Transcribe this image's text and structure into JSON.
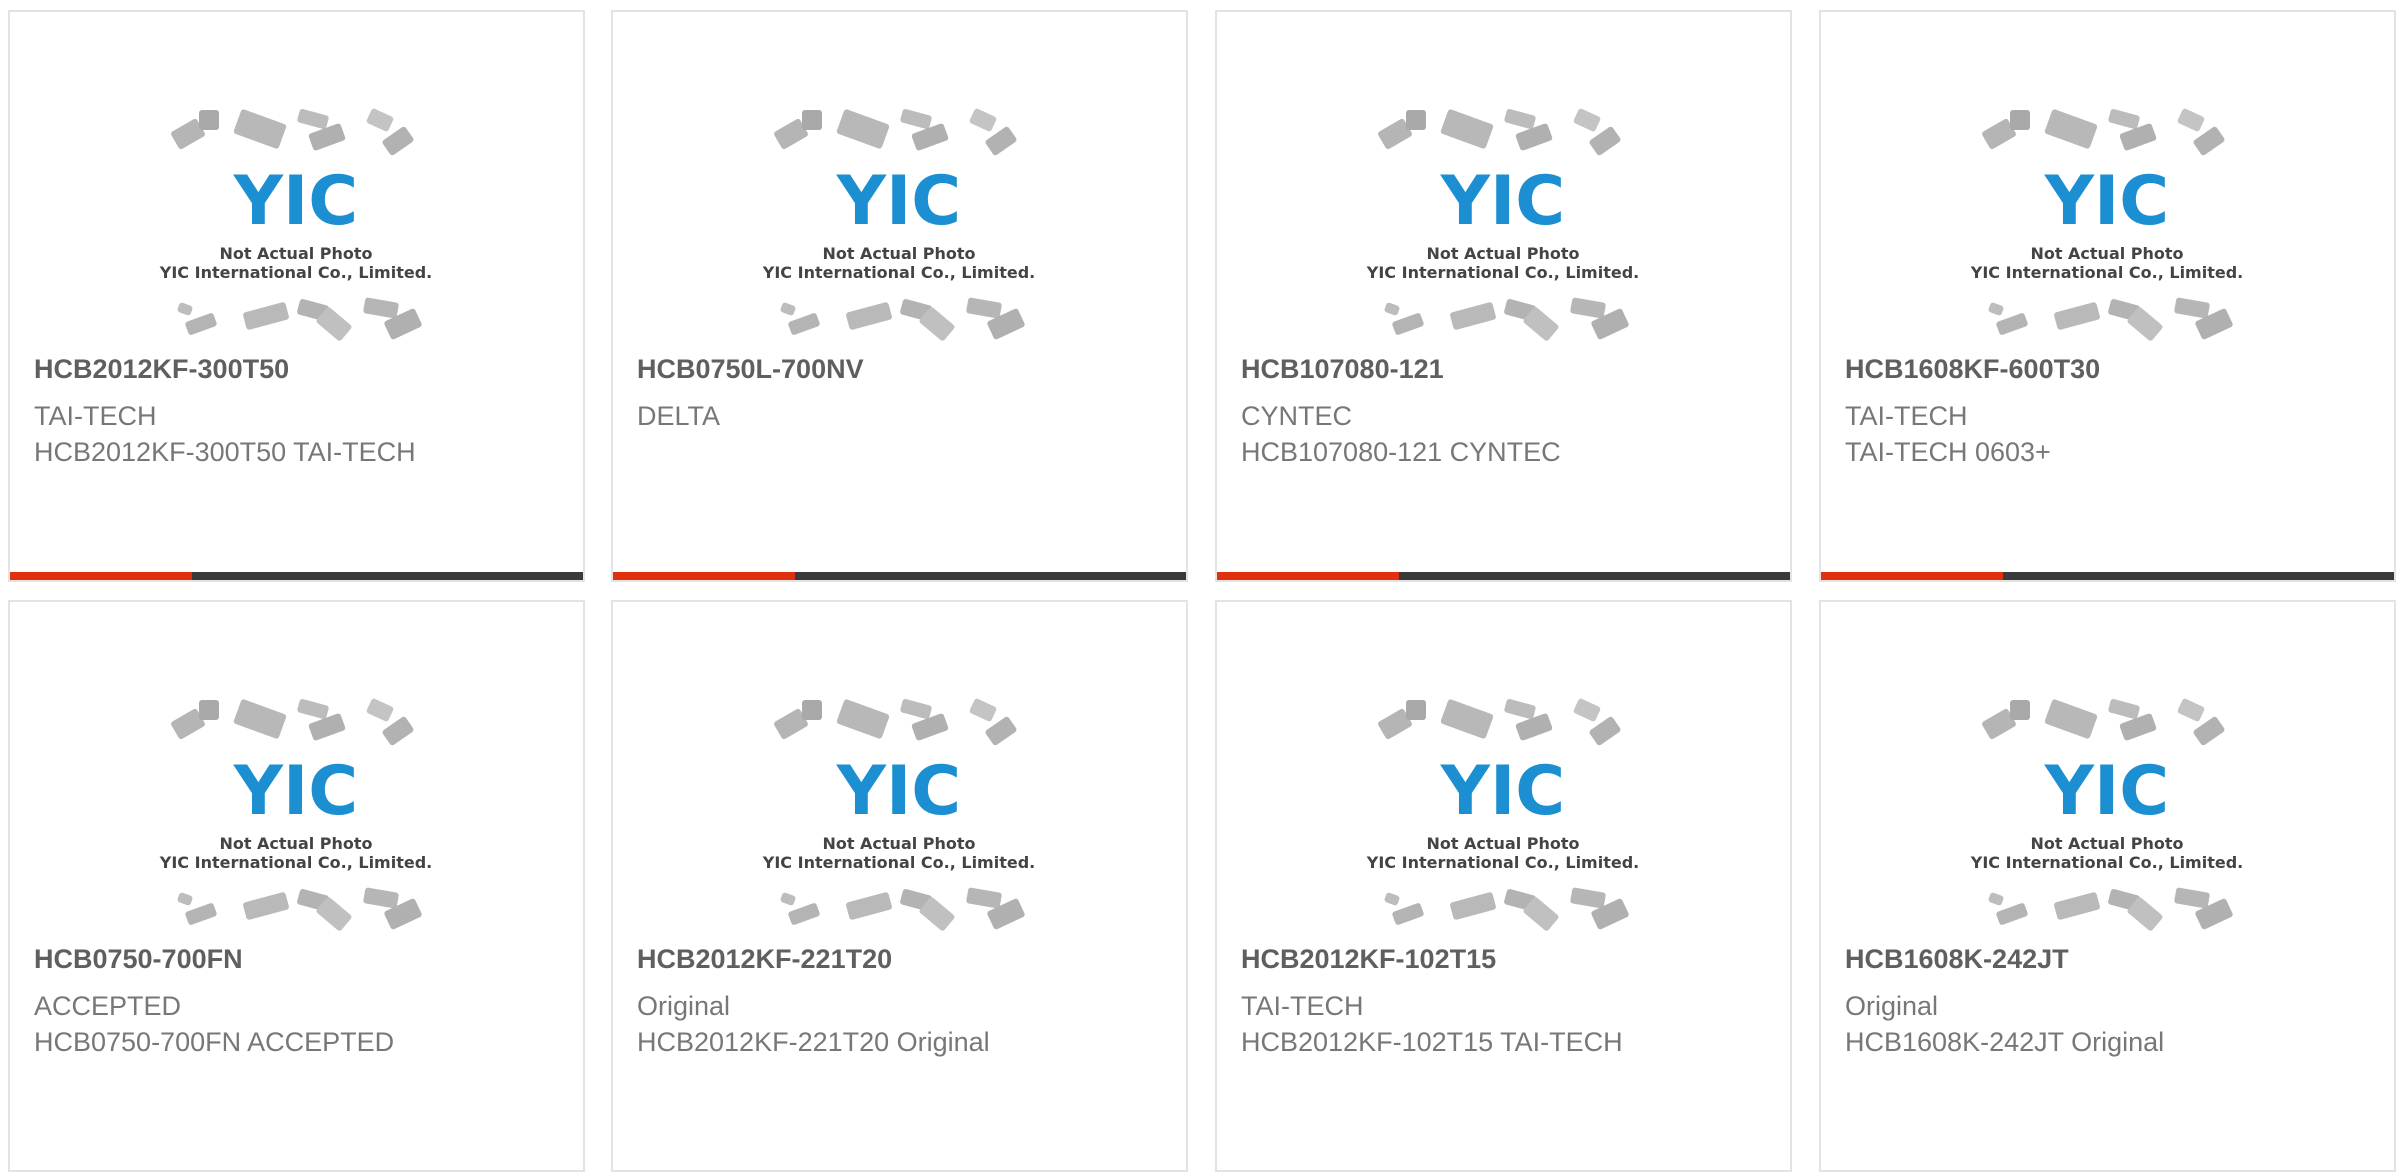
{
  "brand": {
    "accent_color": "#e0300e",
    "bar_color": "#3a3a3a",
    "logo_color": "#1b8fd1"
  },
  "placeholder_image": {
    "logo_text": "YIC",
    "caption_line1": "Not Actual Photo",
    "caption_line2": "YIC International Co., Limited."
  },
  "products": [
    {
      "part": "HCB2012KF-300T50",
      "line1": "TAI-TECH",
      "line2": "HCB2012KF-300T50 TAI-TECH"
    },
    {
      "part": "HCB0750L-700NV",
      "line1": "DELTA",
      "line2": ""
    },
    {
      "part": "HCB107080-121",
      "line1": "CYNTEC",
      "line2": "HCB107080-121 CYNTEC"
    },
    {
      "part": "HCB1608KF-600T30",
      "line1": "TAI-TECH",
      "line2": "TAI-TECH 0603+"
    },
    {
      "part": "HCB0750-700FN",
      "line1": "ACCEPTED",
      "line2": "HCB0750-700FN ACCEPTED"
    },
    {
      "part": "HCB2012KF-221T20",
      "line1": "Original",
      "line2": "HCB2012KF-221T20 Original"
    },
    {
      "part": "HCB2012KF-102T15",
      "line1": "TAI-TECH",
      "line2": "HCB2012KF-102T15 TAI-TECH"
    },
    {
      "part": "HCB1608K-242JT",
      "line1": "Original",
      "line2": "HCB1608K-242JT Original"
    }
  ]
}
